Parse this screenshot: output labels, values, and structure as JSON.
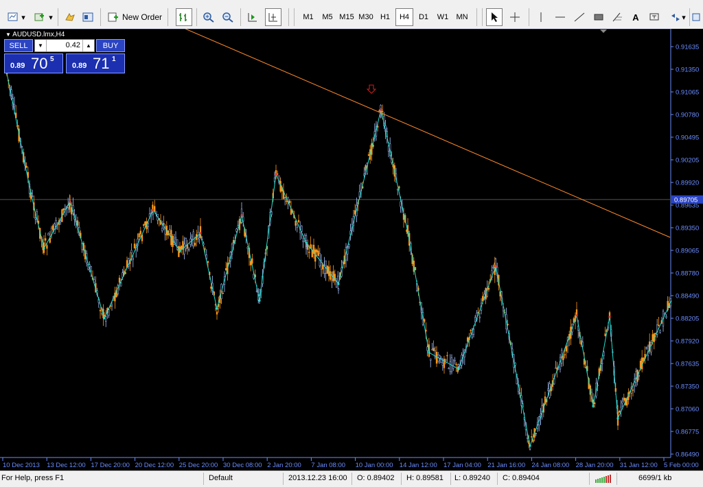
{
  "toolbar": {
    "new_order_label": "New Order",
    "timeframes": [
      "M1",
      "M5",
      "M15",
      "M30",
      "H1",
      "H4",
      "D1",
      "W1",
      "MN"
    ],
    "active_timeframe": "H4"
  },
  "chart": {
    "title": "AUDUSD.lmx,H4",
    "price_labels": [
      "0.91635",
      "0.91350",
      "0.91065",
      "0.90780",
      "0.90495",
      "0.90205",
      "0.89920",
      "0.89635",
      "0.89350",
      "0.89065",
      "0.88780",
      "0.88490",
      "0.88205",
      "0.87920",
      "0.87635",
      "0.87350",
      "0.87060",
      "0.86775",
      "0.86490"
    ],
    "current_price_label": "0.89705",
    "date_labels": [
      "10 Dec 2013",
      "13 Dec 12:00",
      "17 Dec 20:00",
      "20 Dec 12:00",
      "25 Dec 20:00",
      "30 Dec 08:00",
      "2 Jan 20:00",
      "7 Jan 08:00",
      "10 Jan 00:00",
      "14 Jan 12:00",
      "17 Jan 04:00",
      "21 Jan 16:00",
      "24 Jan 08:00",
      "28 Jan 20:00",
      "31 Jan 12:00",
      "5 Feb 00:00"
    ],
    "colors": {
      "bull": "#a9c4ff",
      "bear": "#ff9a1a",
      "zigzag": "#20e0d0",
      "trend": "#ff8a2a",
      "axis": "#6a8cff"
    }
  },
  "trade_panel": {
    "sell_label": "SELL",
    "buy_label": "BUY",
    "lot_value": "0.42",
    "sell_price_prefix": "0.89",
    "sell_price_big": "70",
    "sell_price_sup": "5",
    "buy_price_prefix": "0.89",
    "buy_price_big": "71",
    "buy_price_sup": "1"
  },
  "status": {
    "help": "For Help, press F1",
    "profile": "Default",
    "datetime": "2013.12.23 16:00",
    "open": "O: 0.89402",
    "high": "H: 0.89581",
    "low": "L: 0.89240",
    "close": "C: 0.89404",
    "traffic": "6699/1 kb"
  }
}
